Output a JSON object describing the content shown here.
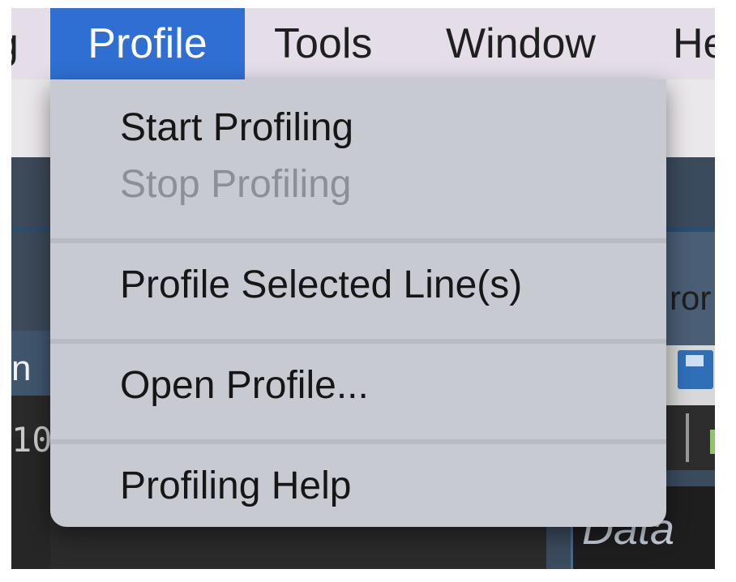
{
  "menubar": {
    "items": [
      {
        "label": "g"
      },
      {
        "label": "Profile"
      },
      {
        "label": "Tools"
      },
      {
        "label": "Window"
      },
      {
        "label": "He"
      }
    ]
  },
  "menu": {
    "items": [
      {
        "label": "Start Profiling",
        "enabled": true
      },
      {
        "label": "Stop Profiling",
        "enabled": false
      },
      {
        "label": "Profile Selected Line(s)",
        "enabled": true
      },
      {
        "label": "Open Profile...",
        "enabled": true
      },
      {
        "label": "Profiling Help",
        "enabled": true
      }
    ]
  },
  "background": {
    "left_label": "n",
    "left_code": "10",
    "right_label": "ror",
    "right_data": "Data"
  },
  "colors": {
    "menubar_bg": "#e5dee9",
    "selected_menu": "#2f6fd3",
    "dropdown_bg": "#c7cad0",
    "disabled_text": "#8c8f95"
  }
}
